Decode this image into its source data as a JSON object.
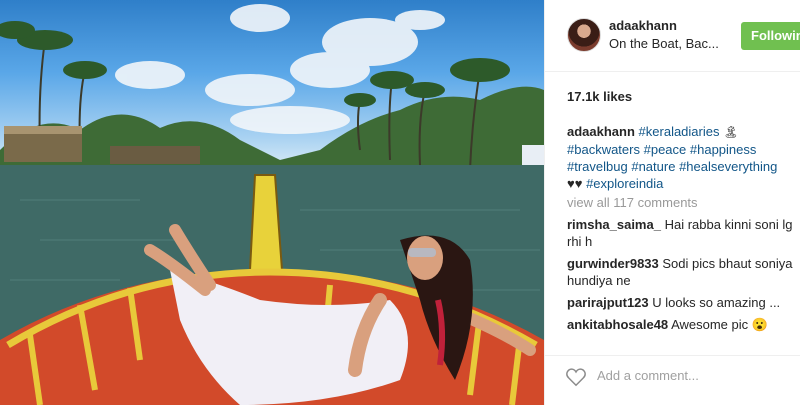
{
  "post": {
    "username": "adaakhann",
    "location": "On the Boat, Bac...",
    "follow_label": "Followin",
    "likes": "17.1k likes"
  },
  "caption": {
    "author": "adaakhann",
    "line1_tag": "#keraladiaries",
    "line2_tags": [
      "#backwaters",
      "#peace",
      "#happiness"
    ],
    "line3_tags": [
      "#travelbug",
      "#nature",
      "#healseverything"
    ],
    "line4_emoji": "♥♥",
    "line4_tag": "#exploreindia"
  },
  "view_all": "view all 117 comments",
  "comments": [
    {
      "user": "rimsha_saima_",
      "text": "Hai rabba kinni soni lg rhi h"
    },
    {
      "user": "gurwinder9833",
      "text": "Sodi pics bhaut soniya hundiya ne"
    },
    {
      "user": "parirajput123",
      "text": "U looks so amazing ..."
    },
    {
      "user": "ankitabhosale48",
      "text": "Awesome pic 😮"
    }
  ],
  "add_comment_placeholder": "Add a comment...",
  "icons": {
    "heart": "heart-outline-icon"
  },
  "colors": {
    "follow_button": "#70c050",
    "hashtag": "#125688",
    "muted_text": "#999999"
  }
}
